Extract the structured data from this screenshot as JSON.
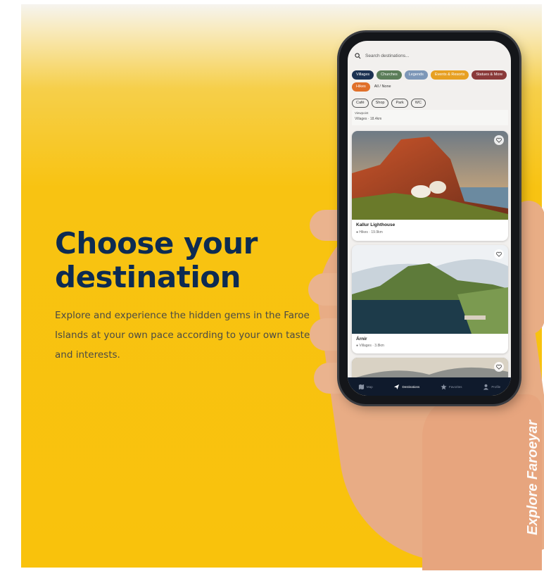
{
  "hero": {
    "title": "Choose your destination",
    "description": "Explore and experience the hidden gems in the Faroe Islands at your own pace according to your own taste and interests."
  },
  "watermark": "Explore Faroeyar",
  "app": {
    "search_placeholder": "Search destinations...",
    "categories": [
      {
        "label": "Villages",
        "color": "#1c3252"
      },
      {
        "label": "Churches",
        "color": "#5b7d59"
      },
      {
        "label": "Legends",
        "color": "#7d97b8"
      },
      {
        "label": "Events & Resorts",
        "color": "#e7a022"
      },
      {
        "label": "Statues & More",
        "color": "#8a3a3a"
      },
      {
        "label": "Hikes",
        "color": "#e0702a"
      }
    ],
    "all_none": "All / None",
    "amenities": [
      "Café",
      "Shop",
      "Park",
      "WC"
    ],
    "previous_card": {
      "name": "Viewpoint",
      "meta": "Villages · 18.4km"
    },
    "cards": [
      {
        "name": "Kallur Lighthouse",
        "category": "Hikes",
        "distance": "19.9km"
      },
      {
        "name": "Árnir",
        "category": "Villages",
        "distance": "3.8km"
      }
    ],
    "nav": [
      {
        "label": "Map",
        "icon": "map-icon",
        "active": false
      },
      {
        "label": "Destinations",
        "icon": "paper-plane-icon",
        "active": true
      },
      {
        "label": "Favorites",
        "icon": "star-icon",
        "active": false
      },
      {
        "label": "Profile",
        "icon": "person-icon",
        "active": false
      }
    ]
  }
}
